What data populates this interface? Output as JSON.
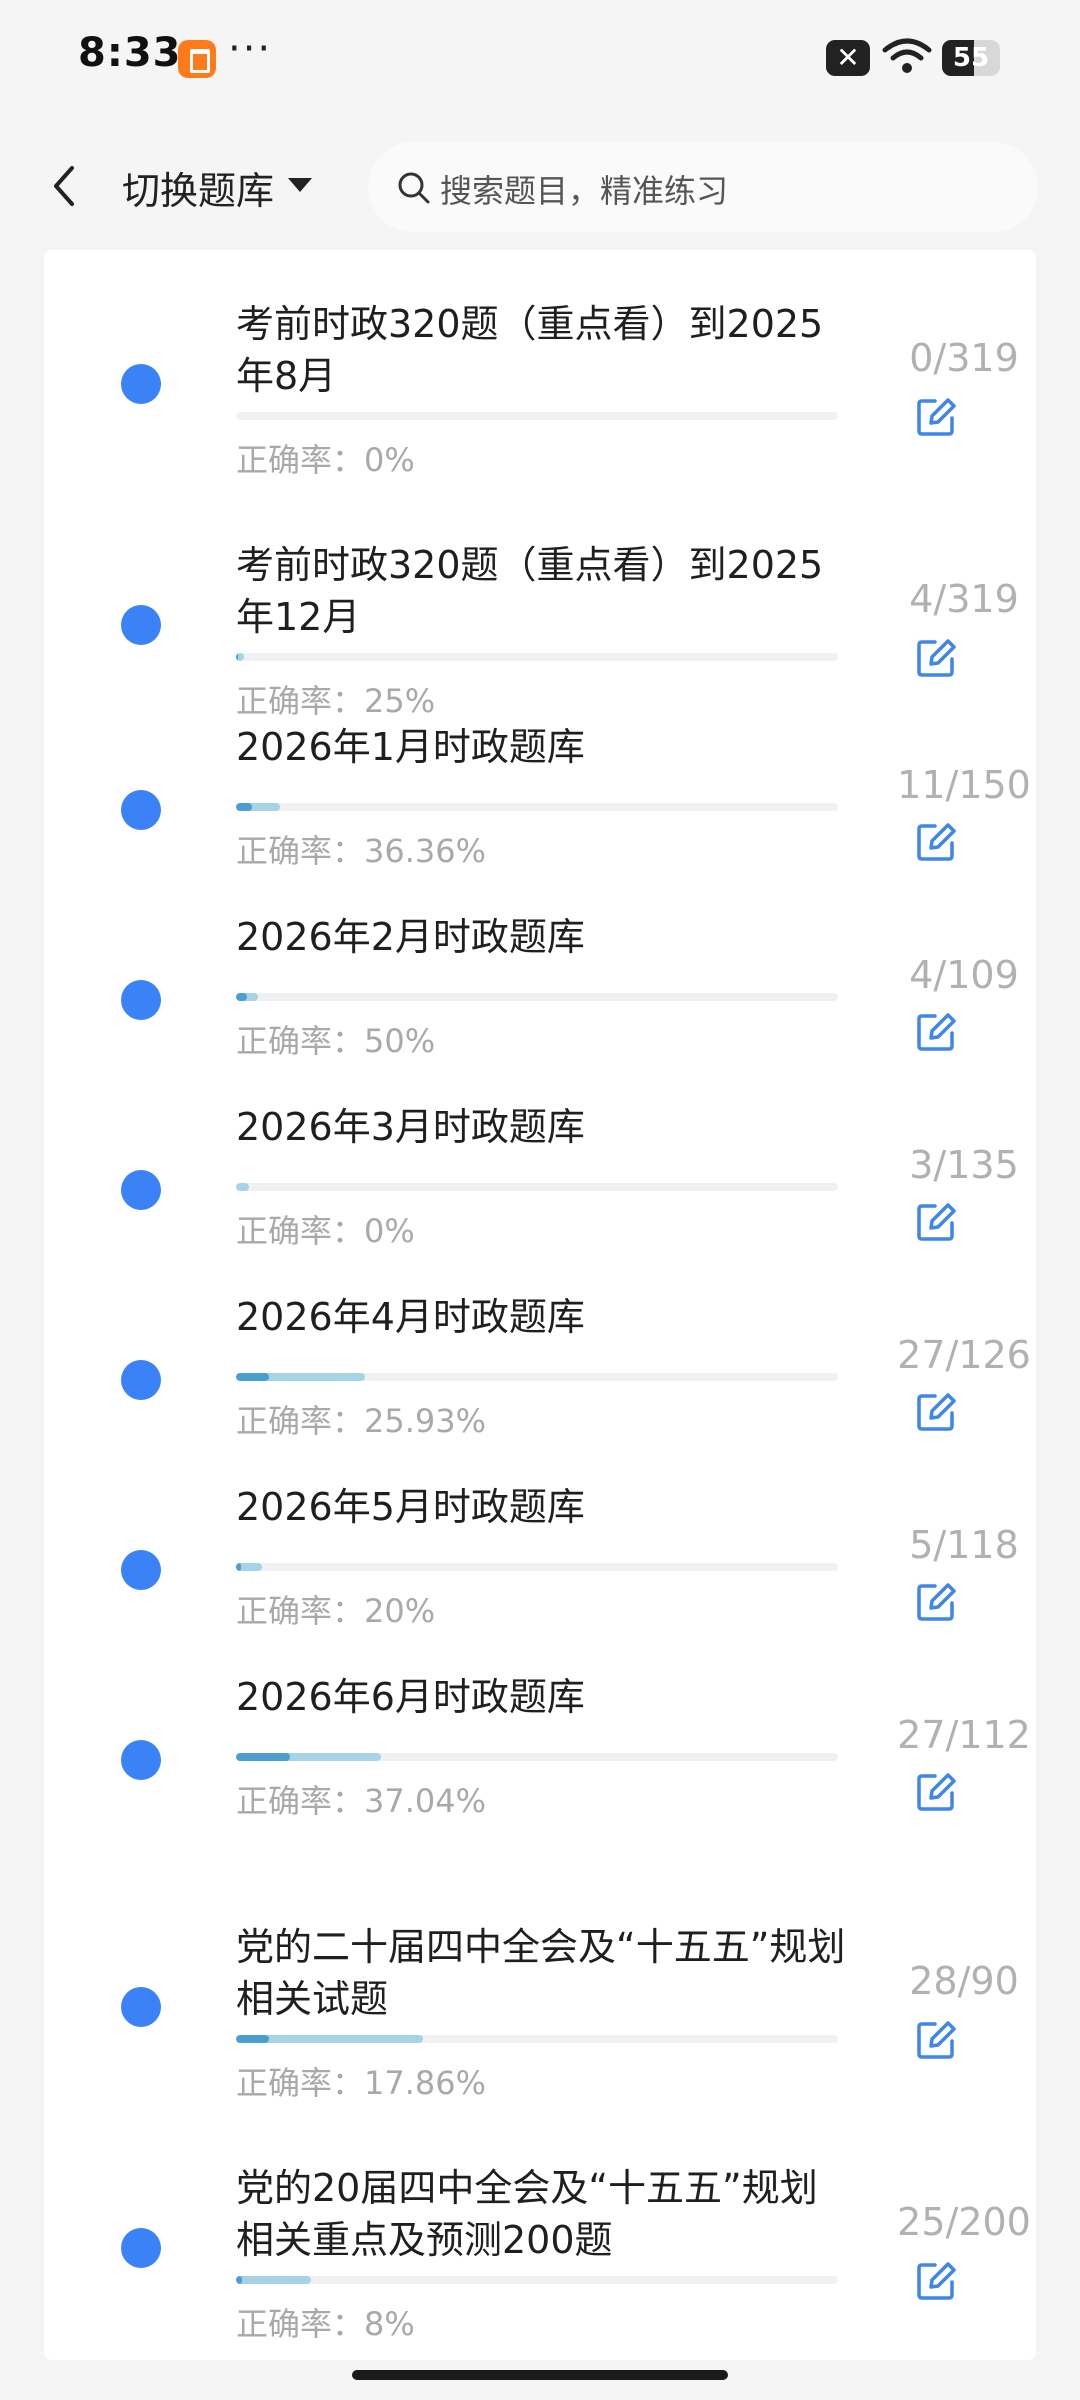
{
  "status_bar": {
    "time": "8:33",
    "dots": "···",
    "battery": "55"
  },
  "header": {
    "title": "切换题库",
    "search_placeholder": "搜索题目，精准练习"
  },
  "colors": {
    "accent": "#3b82f6",
    "bar_done": "#a6d4e6",
    "bar_correct": "#4a9fd0"
  },
  "items": [
    {
      "name": "考前时政320题（重点看）到2025年8月",
      "accuracy": "正确率：0%",
      "count": "0/319",
      "done": 0,
      "total": 319,
      "rate": 0
    },
    {
      "name": "考前时政320题（重点看）到2025年12月",
      "accuracy": "正确率：25%",
      "count": "4/319",
      "done": 4,
      "total": 319,
      "rate": 0.25
    },
    {
      "name": "2026年1月时政题库",
      "accuracy": "正确率：36.36%",
      "count": "11/150",
      "done": 11,
      "total": 150,
      "rate": 0.3636
    },
    {
      "name": "2026年2月时政题库",
      "accuracy": "正确率：50%",
      "count": "4/109",
      "done": 4,
      "total": 109,
      "rate": 0.5
    },
    {
      "name": "2026年3月时政题库",
      "accuracy": "正确率：0%",
      "count": "3/135",
      "done": 3,
      "total": 135,
      "rate": 0
    },
    {
      "name": "2026年4月时政题库",
      "accuracy": "正确率：25.93%",
      "count": "27/126",
      "done": 27,
      "total": 126,
      "rate": 0.2593
    },
    {
      "name": "2026年5月时政题库",
      "accuracy": "正确率：20%",
      "count": "5/118",
      "done": 5,
      "total": 118,
      "rate": 0.2
    },
    {
      "name": "2026年6月时政题库",
      "accuracy": "正确率：37.04%",
      "count": "27/112",
      "done": 27,
      "total": 112,
      "rate": 0.3704
    },
    {
      "name": "党的二十届四中全会及“十五五”规划相关试题",
      "accuracy": "正确率：17.86%",
      "count": "28/90",
      "done": 28,
      "total": 90,
      "rate": 0.1786
    },
    {
      "name": "党的20届四中全会及“十五五”规划相关重点及预测200题",
      "accuracy": "正确率：8%",
      "count": "25/200",
      "done": 25,
      "total": 200,
      "rate": 0.08
    }
  ]
}
